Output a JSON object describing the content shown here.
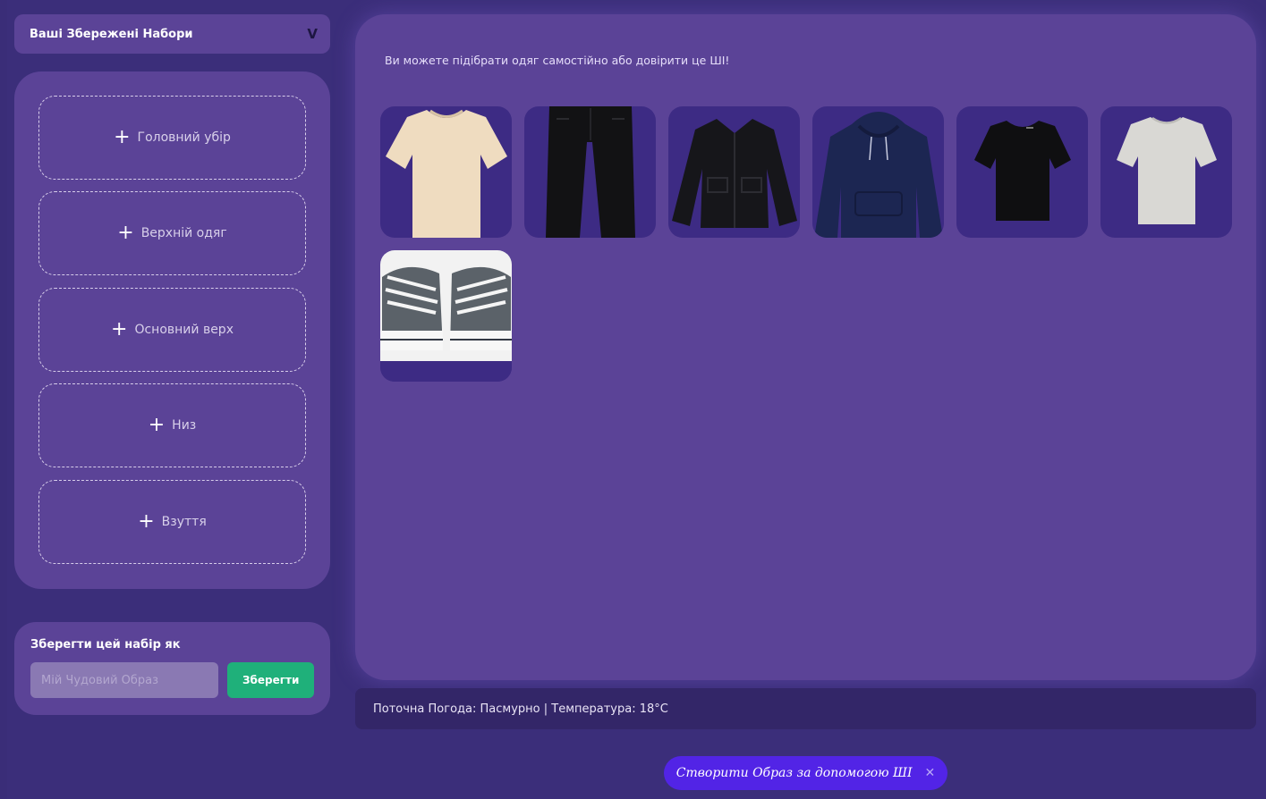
{
  "saved_sets": {
    "label": "Ваші Збережені Набори",
    "chevron_icon": "chevron-down-icon"
  },
  "slots": [
    {
      "label": "Головний убір"
    },
    {
      "label": "Верхній одяг"
    },
    {
      "label": "Основний верх"
    },
    {
      "label": "Низ"
    },
    {
      "label": "Взуття"
    }
  ],
  "save_set": {
    "label": "Зберегти цей набір як",
    "input_placeholder": "Мій Чудовий Образ",
    "button_label": "Зберегти",
    "button_color": "#1fb07a"
  },
  "main": {
    "hint": "Ви можете підібрати одяг самостійно або довірити це ШІ!",
    "items": [
      {
        "kind": "beige-tshirt"
      },
      {
        "kind": "black-pants"
      },
      {
        "kind": "black-jacket"
      },
      {
        "kind": "navy-hoodie"
      },
      {
        "kind": "black-tshirt"
      },
      {
        "kind": "grey-tshirt"
      },
      {
        "kind": "sneakers"
      }
    ]
  },
  "weather": {
    "text": "Поточна Погода: Пасмурно | Температура: 18°C"
  },
  "ai_button": {
    "label": "Створити Образ за допомогою ШІ",
    "close_glyph": "✕",
    "color": "#5224e6"
  }
}
